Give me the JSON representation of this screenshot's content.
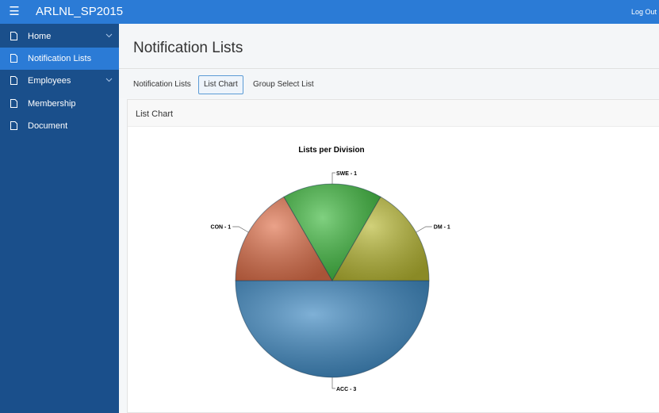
{
  "app": {
    "title": "ARLNL_SP2015",
    "logout_label": "Log Out"
  },
  "sidebar": {
    "items": [
      {
        "label": "Home",
        "expandable": true,
        "active": false
      },
      {
        "label": "Notification Lists",
        "expandable": false,
        "active": true
      },
      {
        "label": "Employees",
        "expandable": true,
        "active": false
      },
      {
        "label": "Membership",
        "expandable": false,
        "active": false
      },
      {
        "label": "Document",
        "expandable": false,
        "active": false
      }
    ]
  },
  "page": {
    "title": "Notification Lists"
  },
  "tabs": [
    {
      "label": "Notification Lists",
      "active": false
    },
    {
      "label": "List Chart",
      "active": true
    },
    {
      "label": "Group Select List",
      "active": false
    }
  ],
  "region": {
    "title": "List Chart"
  },
  "colors": {
    "topbar": "#2b7bd6",
    "sidebar": "#1a4f8b",
    "active_nav": "#2b7bd6"
  },
  "chart_data": {
    "type": "pie",
    "title": "Lists per Division",
    "slices": [
      {
        "name": "ACC",
        "label": "ACC - 3",
        "value": 3,
        "color": "#3a86c0"
      },
      {
        "name": "CON",
        "label": "CON - 1",
        "value": 1,
        "color": "#e0704a"
      },
      {
        "name": "SWE",
        "label": "SWE - 1",
        "value": 1,
        "color": "#3cb83c"
      },
      {
        "name": "DM",
        "label": "DM - 1",
        "value": 1,
        "color": "#b8b832"
      }
    ]
  }
}
